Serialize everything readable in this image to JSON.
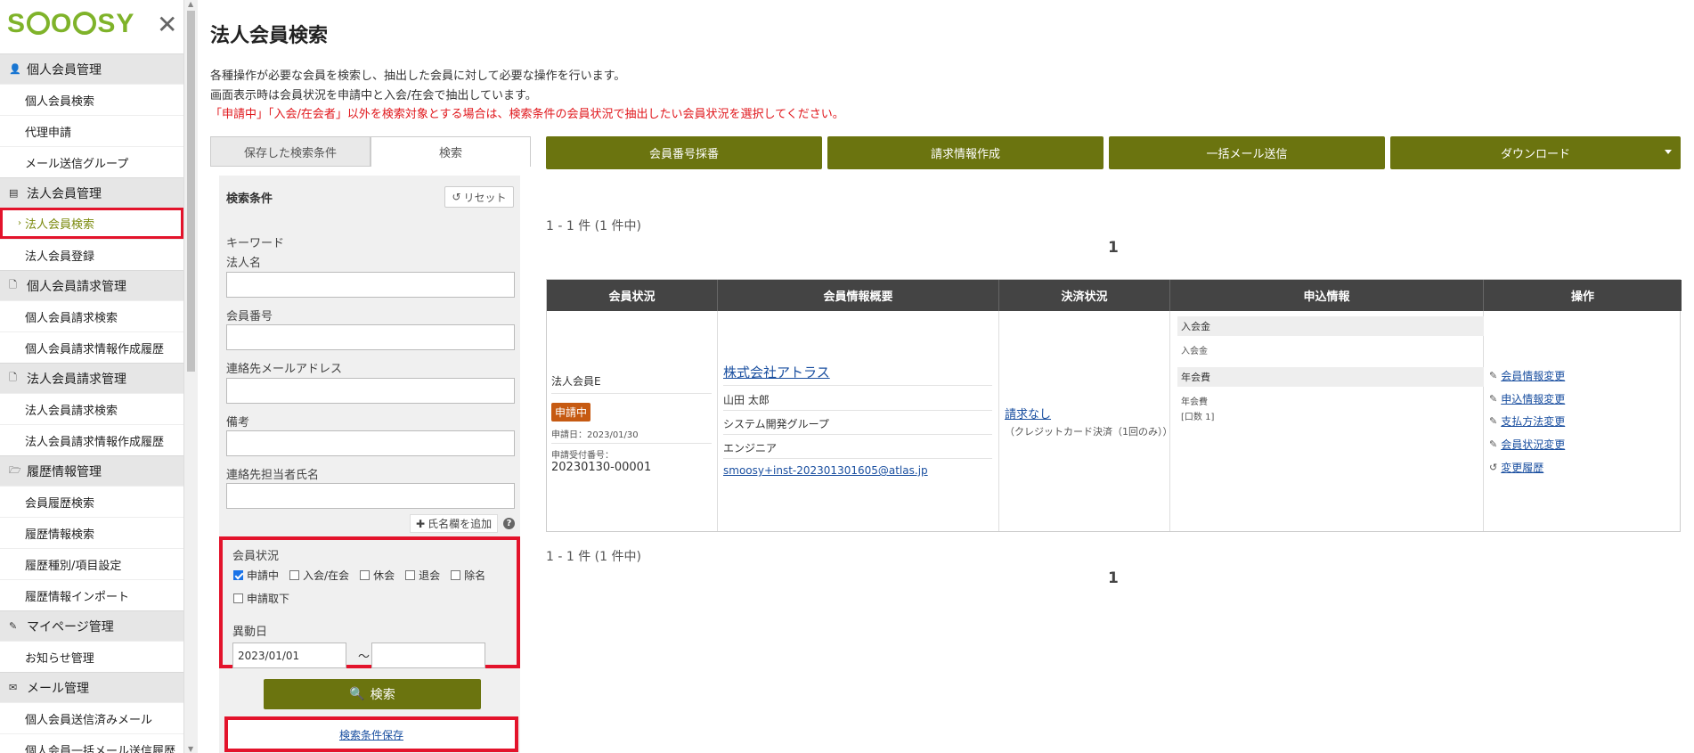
{
  "app": {
    "logo": "SMOOSY"
  },
  "sidebar": {
    "sections": [
      {
        "title": "個人会員管理",
        "icon": "person-icon",
        "items": [
          "個人会員検索",
          "代理申請",
          "メール送信グループ"
        ]
      },
      {
        "title": "法人会員管理",
        "icon": "building-icon",
        "items": [
          "法人会員検索",
          "法人会員登録"
        ]
      },
      {
        "title": "個人会員請求管理",
        "icon": "document-icon",
        "items": [
          "個人会員請求検索",
          "個人会員請求情報作成履歴"
        ]
      },
      {
        "title": "法人会員請求管理",
        "icon": "document-icon",
        "items": [
          "法人会員請求検索",
          "法人会員請求情報作成履歴"
        ]
      },
      {
        "title": "履歴情報管理",
        "icon": "folder-icon",
        "items": [
          "会員履歴検索",
          "履歴情報検索",
          "履歴種別/項目設定",
          "履歴情報インポート"
        ]
      },
      {
        "title": "マイページ管理",
        "icon": "pencil-icon",
        "items": [
          "お知らせ管理"
        ]
      },
      {
        "title": "メール管理",
        "icon": "envelope-icon",
        "items": [
          "個人会員送信済みメール",
          "個人会員一括メール送信履歴"
        ]
      }
    ],
    "active_item": "法人会員検索"
  },
  "main": {
    "title": "法人会員検索",
    "desc1": "各種操作が必要な会員を検索し、抽出した会員に対して必要な操作を行います。",
    "desc2": "画面表示時は会員状況を申請中と入会/在会で抽出しています。",
    "desc3": "「申請中」「入会/在会者」以外を検索対象とする場合は、検索条件の会員状況で抽出したい会員状況を選択してください。"
  },
  "tabs": {
    "saved": "保存した検索条件",
    "search": "検索"
  },
  "search": {
    "title": "検索条件",
    "reset": "リセット",
    "keyword_label": "キーワード",
    "corp_name": "法人名",
    "member_no": "会員番号",
    "email": "連絡先メールアドレス",
    "note": "備考",
    "contact_name": "連絡先担当者氏名",
    "add_name": "氏名欄を追加",
    "help": "?",
    "status_label": "会員状況",
    "statuses": [
      {
        "label": "申請中",
        "checked": true
      },
      {
        "label": "入会/在会",
        "checked": false
      },
      {
        "label": "休会",
        "checked": false
      },
      {
        "label": "退会",
        "checked": false
      },
      {
        "label": "除名",
        "checked": false
      },
      {
        "label": "申請取下",
        "checked": false
      }
    ],
    "move_date_label": "異動日",
    "date_from": "2023/01/01",
    "tilde": "〜",
    "date_to": "",
    "search_button": "検索",
    "save_conditions": "検索条件保存"
  },
  "actions": {
    "assign_no": "会員番号採番",
    "invoice": "請求情報作成",
    "bulk_mail": "一括メール送信",
    "download": "ダウンロード"
  },
  "results": {
    "count": "1 - 1 件 (1 件中)",
    "page": "1",
    "headers": [
      "会員状況",
      "会員情報概要",
      "決済状況",
      "申込情報",
      "操作"
    ],
    "row": {
      "member_type": "法人会員E",
      "status_badge": "申請中",
      "applied_date": "申請日：2023/01/30",
      "receipt_label": "申請受付番号：",
      "receipt_no": "20230130-00001",
      "company": "株式会社アトラス",
      "person": "山田 太郎",
      "group": "システム開発グループ",
      "job": "エンジニア",
      "email": "smoosy+inst-202301301605@atlas.jp",
      "payment": "請求なし",
      "payment_method": "（クレジットカード決済（1回のみ））",
      "entry_fee_title": "入会金",
      "entry_fee_item": "入会金",
      "annual_fee_title": "年会費",
      "annual_fee_item": "年会費",
      "annual_fee_units": "[口数 1]",
      "ops": [
        "会員情報変更",
        "申込情報変更",
        "支払方法変更",
        "会員状況変更"
      ],
      "history": "変更履歴"
    }
  }
}
